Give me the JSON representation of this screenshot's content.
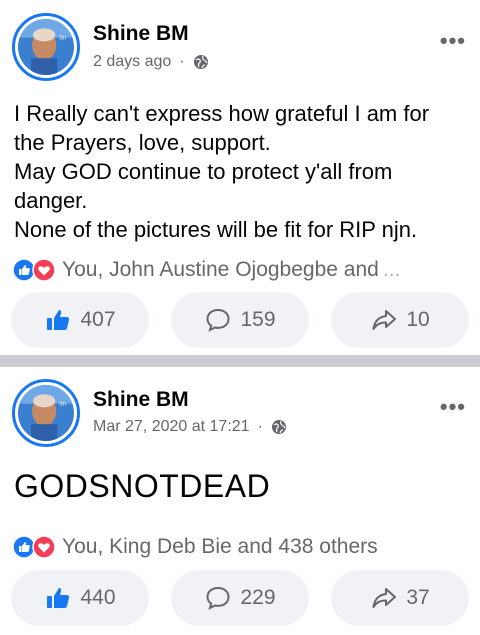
{
  "posts": [
    {
      "author": "Shine BM",
      "time": "2 days ago",
      "separator": "·",
      "more": "•••",
      "text_lines": [
        "I Really can't express how grateful I am for",
        "the Prayers, love, support.",
        "May GOD continue to protect y'all from",
        "danger.",
        "None of the pictures will be fit for RIP njn."
      ],
      "reactions_text": "You, John Austine Ojogbegbe and",
      "reactions_ellipsis": "...",
      "likes": "407",
      "comments": "159",
      "shares": "10"
    },
    {
      "author": "Shine BM",
      "time": "Mar 27, 2020 at 17:21",
      "separator": "·",
      "more": "•••",
      "big_text": "GODSNOTDEAD",
      "reactions_text": "You, King Deb Bie and 438 others",
      "likes": "440",
      "comments": "229",
      "shares": "37"
    }
  ],
  "icons": {
    "like": "thumbs-up-icon",
    "comment": "speech-bubble-icon",
    "share": "share-arrow-icon",
    "privacy": "globe-icon",
    "reaction_like": "like-reaction-icon",
    "reaction_love": "love-reaction-icon"
  },
  "colors": {
    "brand_blue": "#1877f2",
    "love_red": "#f33e58",
    "muted": "#65676b",
    "pill_bg": "#f0f2f5",
    "divider": "#c9ccd1"
  }
}
